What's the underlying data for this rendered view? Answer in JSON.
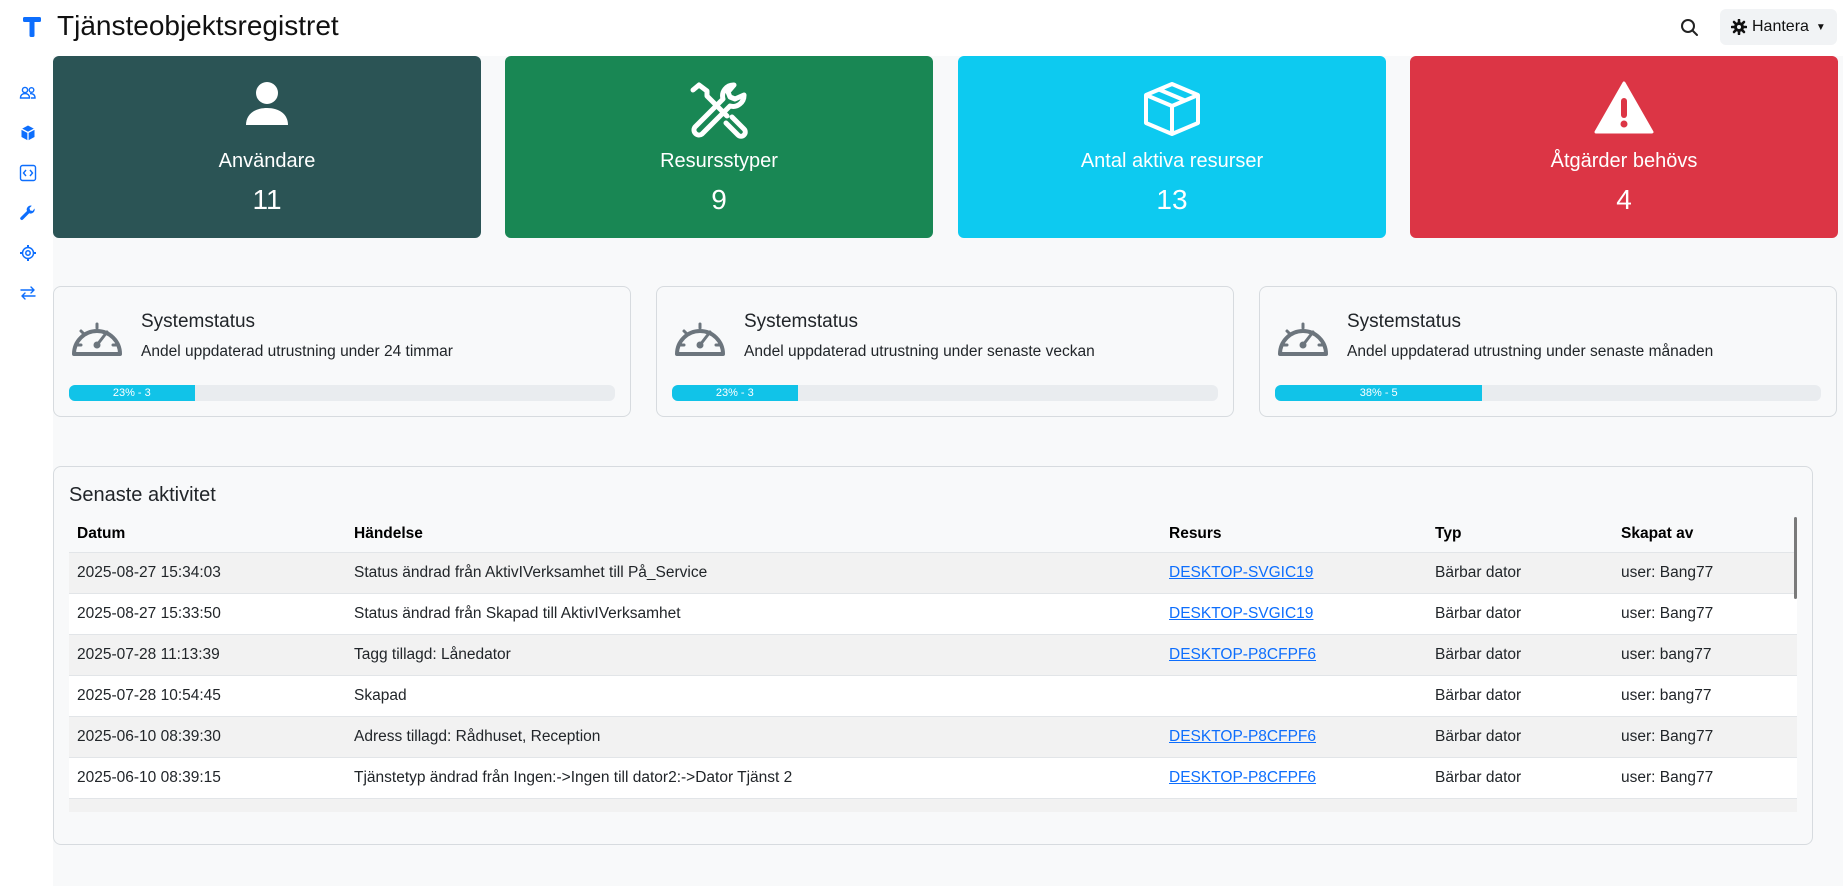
{
  "app": {
    "title": "Tjänsteobjektsregistret",
    "logo_letter": "T"
  },
  "header": {
    "manage_label": "Hantera"
  },
  "colors": {
    "accent": "#0d6efd",
    "card_users": "#2b5455",
    "card_types": "#198754",
    "card_active": "#0dcaf0",
    "card_actions": "#dc3545",
    "progress": "#11c3e8"
  },
  "sidebar": {
    "items": [
      {
        "icon": "users-icon"
      },
      {
        "icon": "cube-icon"
      },
      {
        "icon": "code-icon"
      },
      {
        "icon": "wrench-icon"
      },
      {
        "icon": "gear-icon"
      },
      {
        "icon": "transfer-icon"
      }
    ]
  },
  "stats": [
    {
      "icon": "person-icon",
      "label": "Användare",
      "value": "11"
    },
    {
      "icon": "tools-icon",
      "label": "Resursstyper",
      "value": "9"
    },
    {
      "icon": "box-icon",
      "label": "Antal aktiva resurser",
      "value": "13"
    },
    {
      "icon": "warning-icon",
      "label": "Åtgärder behövs",
      "value": "4"
    }
  ],
  "status_cards": [
    {
      "title": "Systemstatus",
      "description": "Andel uppdaterad utrustning under 24 timmar",
      "percent": 23,
      "progress_text": "23% - 3"
    },
    {
      "title": "Systemstatus",
      "description": "Andel uppdaterad utrustning under senaste veckan",
      "percent": 23,
      "progress_text": "23% - 3"
    },
    {
      "title": "Systemstatus",
      "description": "Andel uppdaterad utrustning under senaste månaden",
      "percent": 38,
      "progress_text": "38% - 5"
    }
  ],
  "activity": {
    "heading": "Senaste aktivitet",
    "columns": [
      "Datum",
      "Händelse",
      "Resurs",
      "Typ",
      "Skapat av"
    ],
    "rows": [
      {
        "date": "2025-08-27 15:34:03",
        "event": "Status ändrad från AktivIVerksamhet till På_Service",
        "resource": "DESKTOP-SVGIC19",
        "type": "Bärbar dator",
        "created_by": "user: Bang77"
      },
      {
        "date": "2025-08-27 15:33:50",
        "event": "Status ändrad från Skapad till AktivIVerksamhet",
        "resource": "DESKTOP-SVGIC19",
        "type": "Bärbar dator",
        "created_by": "user: Bang77"
      },
      {
        "date": "2025-07-28 11:13:39",
        "event": "Tagg tillagd: Lånedator",
        "resource": "DESKTOP-P8CFPF6",
        "type": "Bärbar dator",
        "created_by": "user: bang77"
      },
      {
        "date": "2025-07-28 10:54:45",
        "event": "Skapad",
        "resource": "",
        "type": "Bärbar dator",
        "created_by": "user: bang77"
      },
      {
        "date": "2025-06-10 08:39:30",
        "event": "Adress tillagd: Rådhuset, Reception",
        "resource": "DESKTOP-P8CFPF6",
        "type": "Bärbar dator",
        "created_by": "user: Bang77"
      },
      {
        "date": "2025-06-10 08:39:15",
        "event": "Tjänstetyp ändrad från Ingen:->Ingen till dator2:->Dator Tjänst 2",
        "resource": "DESKTOP-P8CFPF6",
        "type": "Bärbar dator",
        "created_by": "user: Bang77"
      }
    ]
  }
}
